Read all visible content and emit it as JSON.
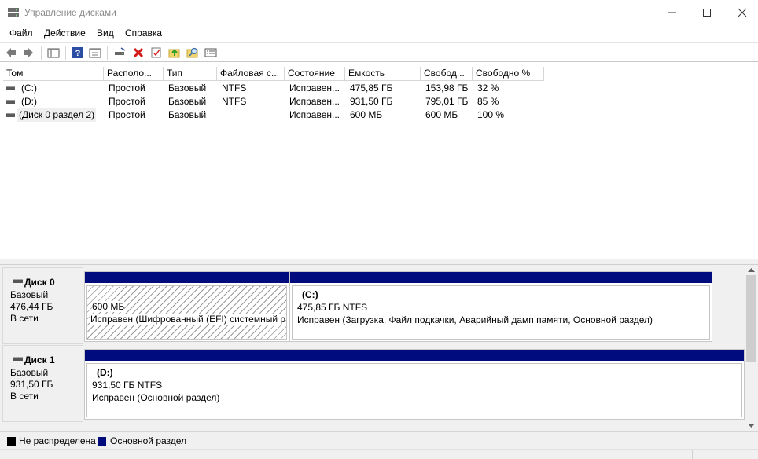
{
  "window": {
    "title": "Управление дисками",
    "controls": {
      "minimize": "—",
      "maximize": "☐",
      "close": "✕"
    }
  },
  "menu": [
    "Файл",
    "Действие",
    "Вид",
    "Справка"
  ],
  "toolbar": [
    "back-icon",
    "forward-icon",
    "console-tree-icon",
    "help-icon",
    "properties-icon",
    "connect-drive-icon",
    "delete-icon",
    "check-icon",
    "up-folder-icon",
    "search-volume-icon",
    "list-view-icon"
  ],
  "columns": [
    "Том",
    "Располо...",
    "Тип",
    "Файловая с...",
    "Состояние",
    "Емкость",
    "Свобод...",
    "Свободно %"
  ],
  "volumes": [
    [
      "(C:)",
      "Простой",
      "Базовый",
      "NTFS",
      "Исправен...",
      "475,85 ГБ",
      "153,98 ГБ",
      "32 %"
    ],
    [
      "(D:)",
      "Простой",
      "Базовый",
      "NTFS",
      "Исправен...",
      "931,50 ГБ",
      "795,01 ГБ",
      "85 %"
    ],
    [
      "(Диск 0 раздел 2)",
      "Простой",
      "Базовый",
      "",
      "Исправен...",
      "600 МБ",
      "600 МБ",
      "100 %"
    ]
  ],
  "disks": [
    {
      "name": "Диск 0",
      "type": "Базовый",
      "size": "476,44 ГБ",
      "status": "В сети",
      "partitions": [
        {
          "title": "",
          "size": "600 МБ",
          "status": "Исправен (Шифрованный (EFI) системный р"
        },
        {
          "title": "(C:)",
          "size": "475,85 ГБ NTFS",
          "status": "Исправен (Загрузка, Файл подкачки, Аварийный дамп памяти, Основной раздел)"
        }
      ]
    },
    {
      "name": "Диск 1",
      "type": "Базовый",
      "size": "931,50 ГБ",
      "status": "В сети",
      "partitions": [
        {
          "title": "(D:)",
          "size": "931,50 ГБ NTFS",
          "status": "Исправен (Основной раздел)"
        }
      ]
    }
  ],
  "legend": [
    {
      "label": "Не распределена",
      "color": "#000000"
    },
    {
      "label": "Основной раздел",
      "color": "#000c7e"
    }
  ]
}
